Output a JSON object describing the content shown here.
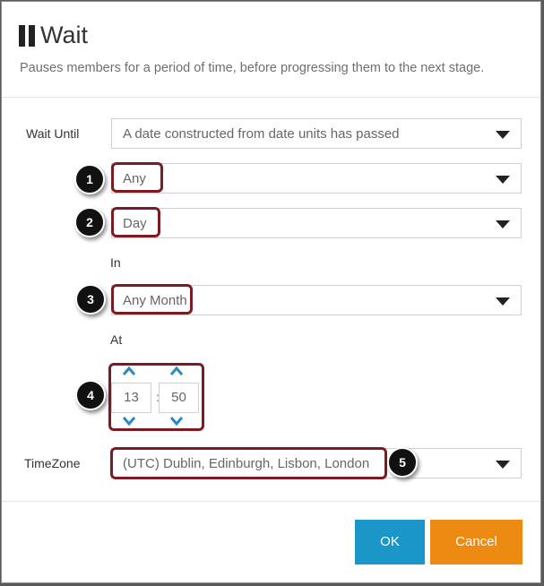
{
  "dialog": {
    "title": "Wait",
    "subtitle": "Pauses members for a period of time, before progressing them to the next stage.",
    "pause_icon": "pause-icon"
  },
  "form": {
    "wait_until_label": "Wait Until",
    "wait_until_value": "A date constructed from date units has passed",
    "day_qualifier_value": "Any",
    "day_unit_value": "Day",
    "in_label": "In",
    "month_value": "Any Month",
    "at_label": "At",
    "hour_value": "13",
    "time_separator": ":",
    "minute_value": "50",
    "timezone_label": "TimeZone",
    "timezone_value": "(UTC) Dublin, Edinburgh, Lisbon, London"
  },
  "markers": [
    "1",
    "2",
    "3",
    "4",
    "5"
  ],
  "buttons": {
    "ok_label": "OK",
    "cancel_label": "Cancel"
  },
  "colors": {
    "ok": "#1b96c8",
    "cancel": "#ec8a12",
    "highlight": "#7a1c22",
    "chevron": "#2a89c2"
  }
}
